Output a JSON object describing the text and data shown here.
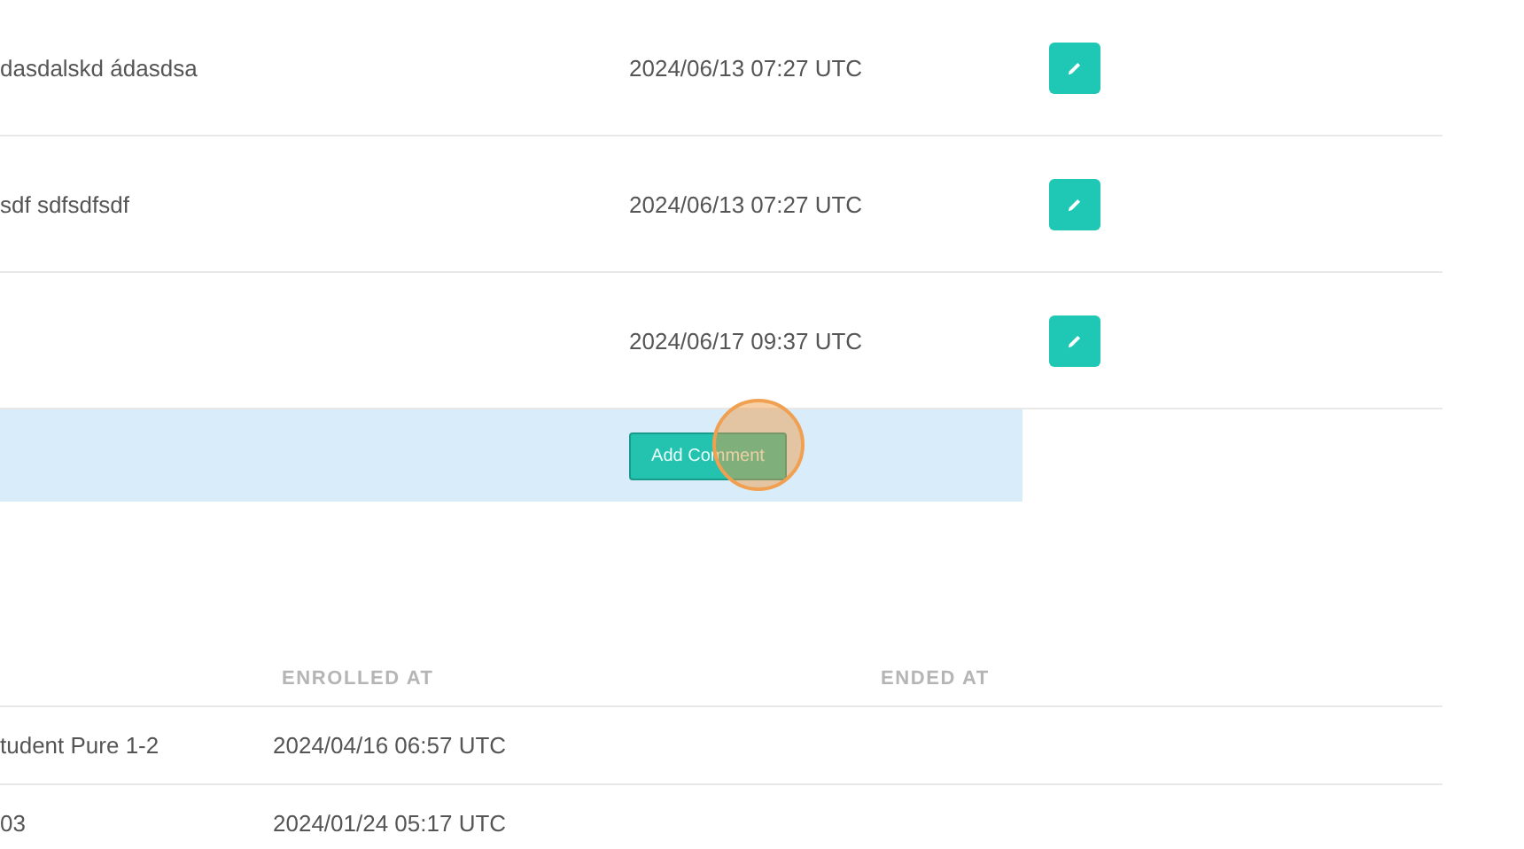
{
  "comments": {
    "rows": [
      {
        "text": "dasdalskd ádasdsa",
        "date": "2024/06/13 07:27 UTC"
      },
      {
        "text": "sdf sdfsdfsdf",
        "date": "2024/06/13 07:27 UTC"
      },
      {
        "text": "",
        "date": "2024/06/17 09:37 UTC"
      }
    ],
    "add_button": "Add Comment"
  },
  "enrollments": {
    "columns": [
      "ENROLLED AT",
      "ENDED AT"
    ],
    "rows": [
      {
        "column_1": "tudent Pure 1-2",
        "enrolled_at": "2024/04/16 06:57 UTC"
      },
      {
        "column_1": "03",
        "enrolled_at": "2024/01/24 05:17 UTC"
      }
    ]
  }
}
